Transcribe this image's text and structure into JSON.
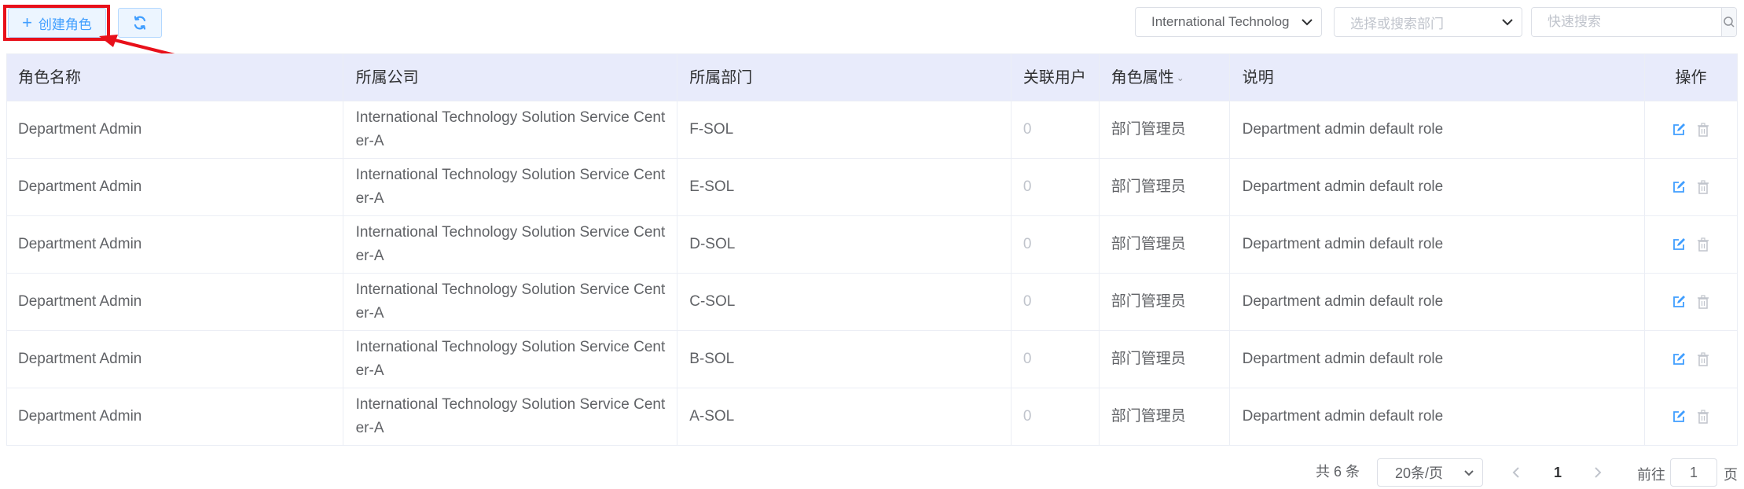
{
  "toolbar": {
    "create_label": "创建角色",
    "refresh_icon": "refresh-icon",
    "company_select_value": "International Technolog",
    "department_select_placeholder": "选择或搜索部门",
    "search_placeholder": "快速搜索"
  },
  "annotation": {
    "highlight_color": "#e8101a"
  },
  "table": {
    "columns": [
      "角色名称",
      "所属公司",
      "所属部门",
      "关联用户",
      "角色属性",
      "说明",
      "操作"
    ],
    "rows": [
      {
        "name": "Department Admin",
        "company": "International Technology Solution Service Center-A",
        "department": "F-SOL",
        "users": "0",
        "attribute": "部门管理员",
        "description": "Department admin default role"
      },
      {
        "name": "Department Admin",
        "company": "International Technology Solution Service Center-A",
        "department": "E-SOL",
        "users": "0",
        "attribute": "部门管理员",
        "description": "Department admin default role"
      },
      {
        "name": "Department Admin",
        "company": "International Technology Solution Service Center-A",
        "department": "D-SOL",
        "users": "0",
        "attribute": "部门管理员",
        "description": "Department admin default role"
      },
      {
        "name": "Department Admin",
        "company": "International Technology Solution Service Center-A",
        "department": "C-SOL",
        "users": "0",
        "attribute": "部门管理员",
        "description": "Department admin default role"
      },
      {
        "name": "Department Admin",
        "company": "International Technology Solution Service Center-A",
        "department": "B-SOL",
        "users": "0",
        "attribute": "部门管理员",
        "description": "Department admin default role"
      },
      {
        "name": "Department Admin",
        "company": "International Technology Solution Service Center-A",
        "department": "A-SOL",
        "users": "0",
        "attribute": "部门管理员",
        "description": "Department admin default role"
      }
    ]
  },
  "pagination": {
    "total_label": "共 6 条",
    "page_size": "20条/页",
    "current_page": "1",
    "goto_label": "前往",
    "goto_value": "1",
    "goto_unit": "页"
  },
  "colors": {
    "primary": "#409eff",
    "header_bg": "#e8ebfb",
    "border": "#ebeef5"
  }
}
